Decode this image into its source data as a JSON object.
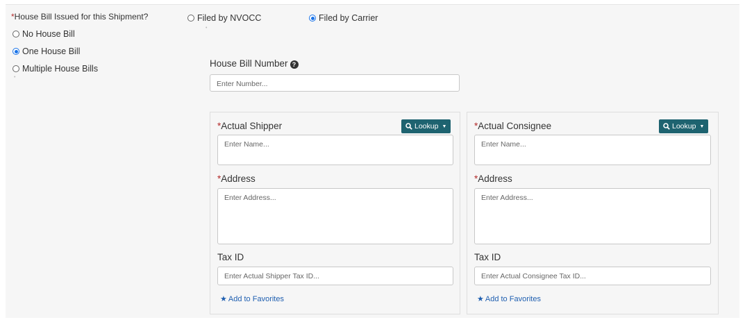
{
  "house_bill": {
    "required_mark": "*",
    "question": "House Bill Issued for this Shipment?",
    "options": [
      {
        "label": "No House Bill",
        "selected": false
      },
      {
        "label": "One House Bill",
        "selected": true
      },
      {
        "label": "Multiple House Bills",
        "selected": false
      }
    ]
  },
  "filed_by": {
    "options": [
      {
        "label": "Filed by NVOCC",
        "selected": false
      },
      {
        "label": "Filed by Carrier",
        "selected": true
      }
    ]
  },
  "house_bill_number": {
    "label": "House Bill Number",
    "help_icon": "question-circle-icon",
    "help_glyph": "?",
    "placeholder": "Enter Number..."
  },
  "shipper": {
    "required_mark": "*",
    "label": "Actual Shipper",
    "lookup_label": "Lookup",
    "name_placeholder": "Enter Name...",
    "address_label": "Address",
    "address_placeholder": "Enter Address...",
    "tax_label": "Tax ID",
    "tax_placeholder": "Enter Actual Shipper Tax ID...",
    "favorites_label": "Add to Favorites"
  },
  "consignee": {
    "required_mark": "*",
    "label": "Actual Consignee",
    "lookup_label": "Lookup",
    "name_placeholder": "Enter Name...",
    "address_label": "Address",
    "address_placeholder": "Enter Address...",
    "tax_label": "Tax ID",
    "tax_placeholder": "Enter Actual Consignee Tax ID...",
    "favorites_label": "Add to Favorites"
  },
  "colors": {
    "lookup_bg": "#1e6370",
    "required": "#b22a2a",
    "link": "#1f5fb0",
    "radio_selected": "#1a73e8"
  }
}
